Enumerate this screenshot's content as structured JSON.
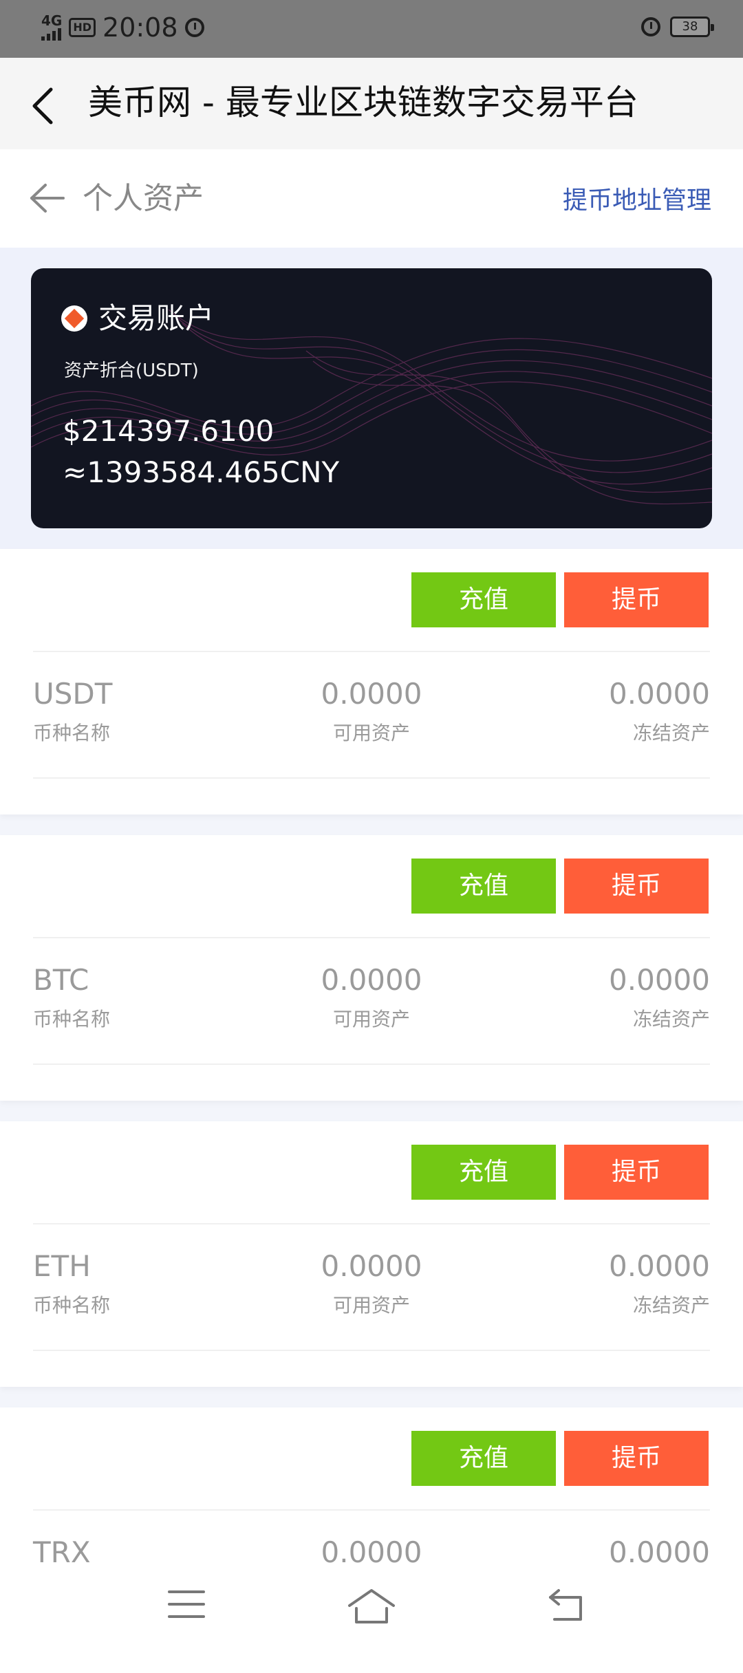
{
  "status_bar": {
    "network": "4G",
    "hd_badge": "HD",
    "time": "20:08",
    "battery": "38"
  },
  "app_bar": {
    "title": "美币网 - 最专业区块链数字交易平台"
  },
  "page_header": {
    "title": "个人资产",
    "address_link": "提币地址管理"
  },
  "account_card": {
    "name": "交易账户",
    "subtitle": "资产折合(USDT)",
    "usdt_value": "$214397.6100",
    "cny_value": "≈1393584.465CNY"
  },
  "labels": {
    "deposit": "充值",
    "withdraw": "提币",
    "coin_name": "币种名称",
    "available": "可用资产",
    "frozen": "冻结资产"
  },
  "assets": [
    {
      "coin": "USDT",
      "available": "0.0000",
      "frozen": "0.0000"
    },
    {
      "coin": "BTC",
      "available": "0.0000",
      "frozen": "0.0000"
    },
    {
      "coin": "ETH",
      "available": "0.0000",
      "frozen": "0.0000"
    },
    {
      "coin": "TRX",
      "available": "0.0000",
      "frozen": "0.0000"
    }
  ],
  "colors": {
    "deposit_green": "#73c814",
    "withdraw_orange": "#ff5e39",
    "link_blue": "#3a5bb5",
    "card_dark": "#121521"
  },
  "icons": {
    "app_back": "chevron-left-icon",
    "page_back": "arrow-left-icon",
    "nav_menu": "menu-icon",
    "nav_home": "home-icon",
    "nav_back": "return-icon"
  }
}
